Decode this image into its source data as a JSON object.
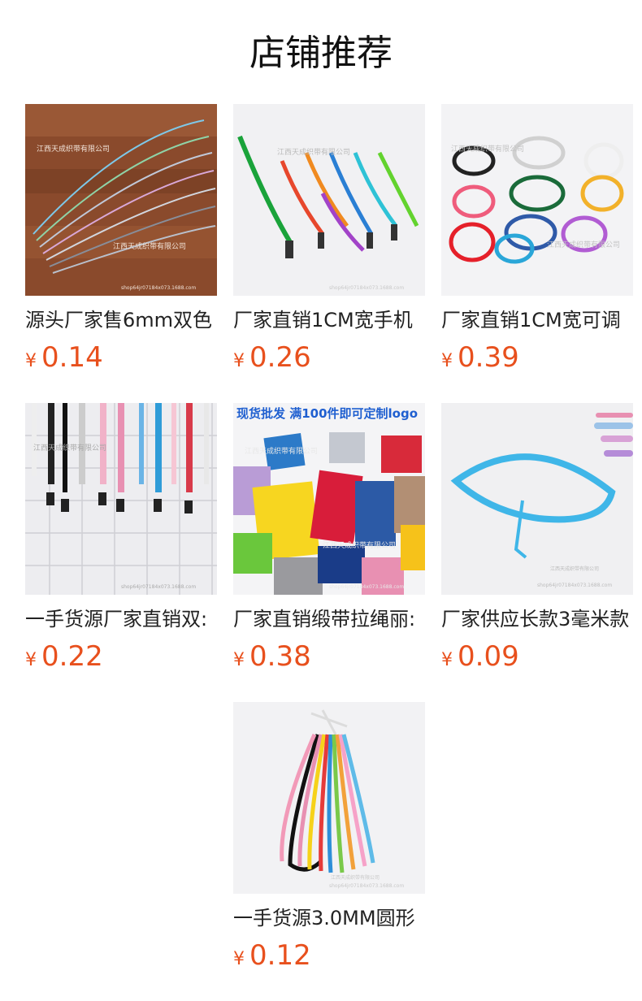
{
  "header": {
    "title": "店铺推荐"
  },
  "products": [
    {
      "name": "源头厂家售6mm双色",
      "currency": "¥",
      "price": "0.14",
      "image_watermarks": [
        "江西天成织带有限公司",
        "江西天成织带有限公司",
        "shop64jr07184x073.1688.com"
      ]
    },
    {
      "name": "厂家直销1CM宽手机",
      "currency": "¥",
      "price": "0.26",
      "image_watermarks": [
        "江西天成织带有限公司",
        "shop64jr07184x073.1688.com"
      ]
    },
    {
      "name": "厂家直销1CM宽可调",
      "currency": "¥",
      "price": "0.39",
      "image_watermarks": [
        "江西天成织带有限公司",
        "江西天成织带有限公司"
      ]
    },
    {
      "name": "一手货源厂家直销双:",
      "currency": "¥",
      "price": "0.22",
      "image_watermarks": [
        "江西天成织带有限公司",
        "shop64jr07184x073.1688.com"
      ]
    },
    {
      "name": "厂家直销缎带拉绳丽:",
      "currency": "¥",
      "price": "0.38",
      "image_banner": "现货批发  满100件即可定制logo",
      "image_watermarks": [
        "江西天成织带有限公司",
        "江西天成织带有限公司",
        "shop64jr07184x073.1688.com"
      ]
    },
    {
      "name": "厂家供应长款3毫米款",
      "currency": "¥",
      "price": "0.09",
      "image_watermarks": [
        "江西天成织带有限公司",
        "shop64jr07184x073.1688.com"
      ]
    },
    {
      "name": "一手货源3.0MM圆形",
      "currency": "¥",
      "price": "0.12",
      "image_watermarks": [
        "江西天成织带有限公司",
        "shop64jr07184x073.1688.com"
      ]
    }
  ]
}
